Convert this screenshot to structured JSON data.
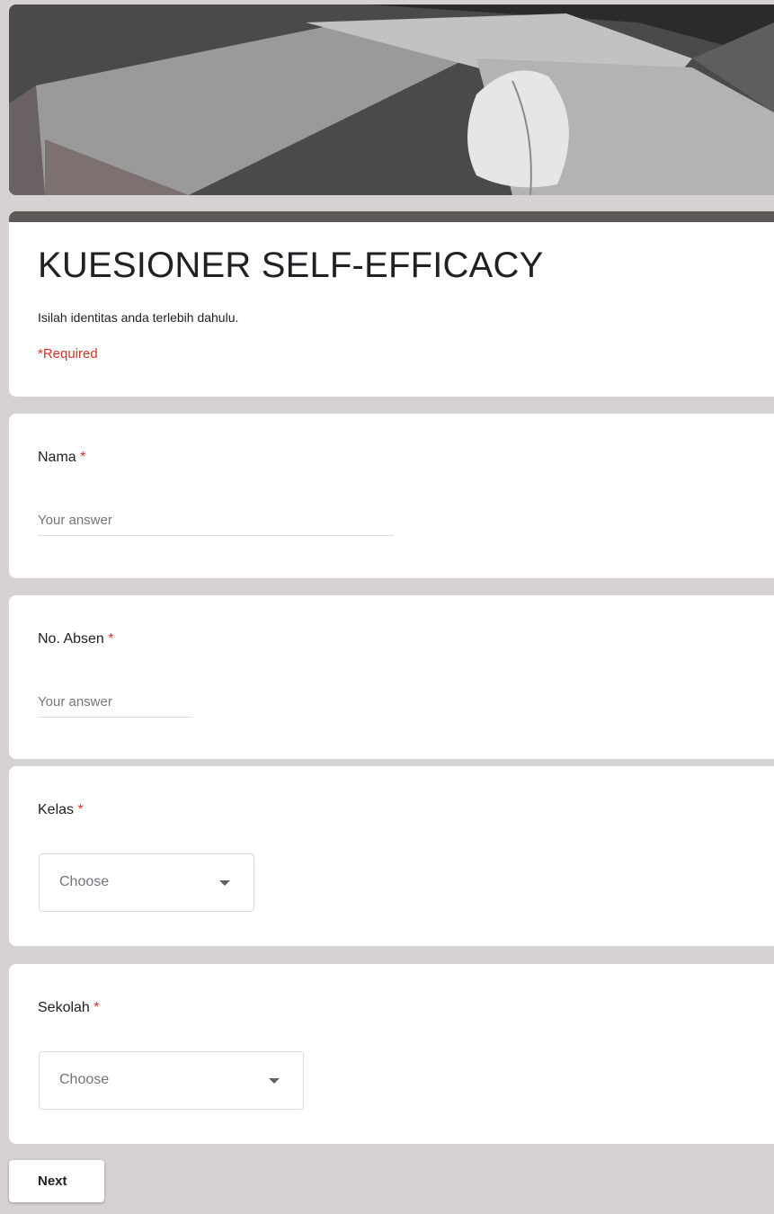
{
  "form": {
    "title": "KUESIONER SELF-EFFICACY",
    "description": "Isilah identitas anda terlebih dahulu.",
    "required_note": "*Required",
    "header_bar_color": "#5f5856"
  },
  "questions": [
    {
      "label": "Nama",
      "required_mark": "*",
      "type": "short-text",
      "placeholder": "Your answer"
    },
    {
      "label": "No. Absen",
      "required_mark": "*",
      "type": "short-text",
      "placeholder": "Your answer"
    },
    {
      "label": "Kelas",
      "required_mark": "*",
      "type": "dropdown",
      "selected": "Choose"
    },
    {
      "label": "Sekolah",
      "required_mark": "*",
      "type": "dropdown",
      "selected": "Choose"
    }
  ],
  "navigation": {
    "next_label": "Next"
  },
  "colors": {
    "required": "#d93025",
    "background": "#d6d2d1",
    "card": "#ffffff"
  },
  "icons": {
    "dropdown": "caret-down-icon",
    "banner": "book-and-feather-image"
  }
}
